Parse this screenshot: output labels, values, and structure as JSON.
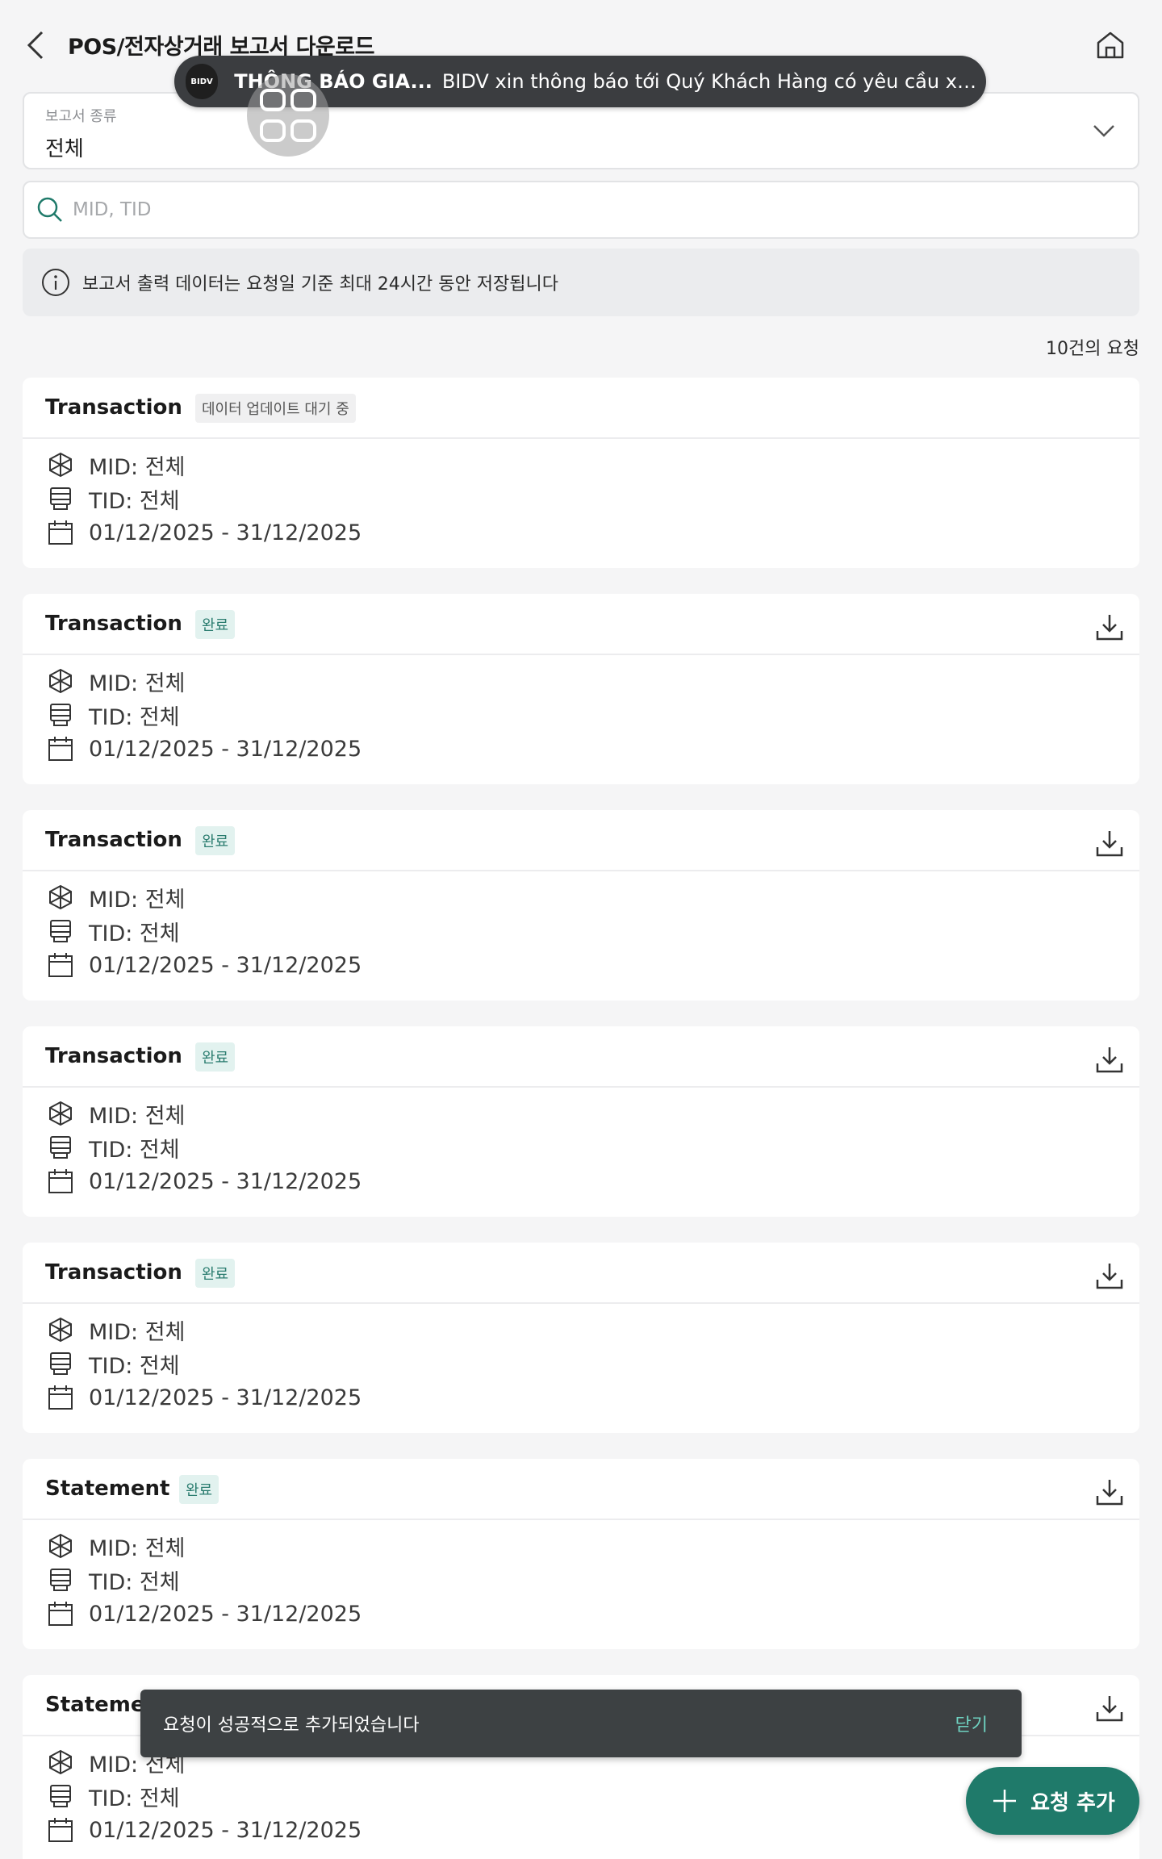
{
  "header": {
    "title": "POS/전자상거래 보고서 다운로드"
  },
  "notification": {
    "logo": "BIDV",
    "title": "THÔNG BÁO GIA...",
    "body": "BIDV xin thông báo tới Quý Khách Hàng có yêu cầu xuất bá..."
  },
  "report_type": {
    "label": "보고서 종류",
    "value": "전체"
  },
  "search": {
    "placeholder": "MID, TID",
    "value": ""
  },
  "info": {
    "text": "보고서 출력 데이터는 요청일 기준 최대 24시간 동안 저장됩니다"
  },
  "count_text": "10건의 요청",
  "cards": [
    {
      "title": "Transaction",
      "status": "데이터 업데이트 대기 중",
      "status_type": "wait",
      "mid": "MID: 전체",
      "tid": "TID: 전체",
      "date": "01/12/2025 - 31/12/2025",
      "downloadable": false
    },
    {
      "title": "Transaction",
      "status": "완료",
      "status_type": "done",
      "mid": "MID: 전체",
      "tid": "TID: 전체",
      "date": "01/12/2025 - 31/12/2025",
      "downloadable": true
    },
    {
      "title": "Transaction",
      "status": "완료",
      "status_type": "done",
      "mid": "MID: 전체",
      "tid": "TID: 전체",
      "date": "01/12/2025 - 31/12/2025",
      "downloadable": true
    },
    {
      "title": "Transaction",
      "status": "완료",
      "status_type": "done",
      "mid": "MID: 전체",
      "tid": "TID: 전체",
      "date": "01/12/2025 - 31/12/2025",
      "downloadable": true
    },
    {
      "title": "Transaction",
      "status": "완료",
      "status_type": "done",
      "mid": "MID: 전체",
      "tid": "TID: 전체",
      "date": "01/12/2025 - 31/12/2025",
      "downloadable": true
    },
    {
      "title": "Statement",
      "status": "완료",
      "status_type": "done",
      "mid": "MID: 전체",
      "tid": "TID: 전체",
      "date": "01/12/2025 - 31/12/2025",
      "downloadable": true
    },
    {
      "title": "Statement",
      "status": "",
      "status_type": "done",
      "mid": "MID: 전체",
      "tid": "TID: 전체",
      "date": "01/12/2025 - 31/12/2025",
      "downloadable": true
    }
  ],
  "toast": {
    "message": "요청이 성공적으로 추가되었습니다",
    "close_label": "닫기"
  },
  "fab": {
    "label": "요청 추가"
  },
  "colors": {
    "accent": "#1f7a6a",
    "badge_done_bg": "#e2f2ef",
    "badge_done_fg": "#2a7c6f",
    "toast_bg": "#3d4143"
  },
  "icons": {
    "back": "chevron-left-icon",
    "home": "home-icon",
    "search": "search-icon",
    "info": "info-icon",
    "download": "download-icon",
    "mid": "cube-icon",
    "tid": "terminal-icon",
    "date": "calendar-icon",
    "add": "plus-icon"
  }
}
